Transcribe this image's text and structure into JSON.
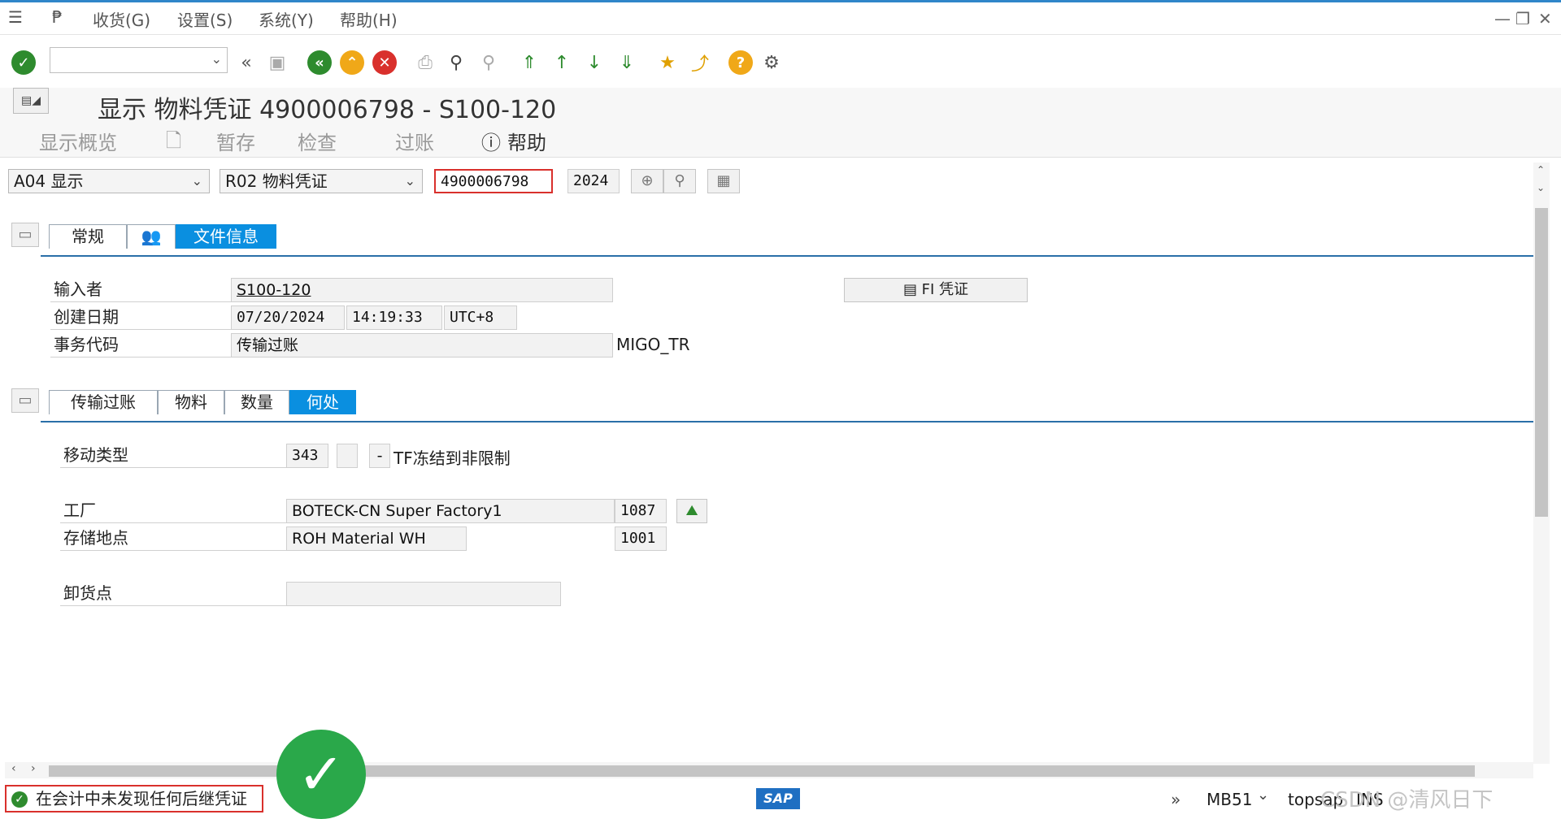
{
  "menubar": {
    "items": [
      "收货(G)",
      "设置(S)",
      "系统(Y)",
      "帮助(H)"
    ]
  },
  "title": "显示 物料凭证 4900006798 - S100-120",
  "app_toolbar": {
    "overview": "显示概览",
    "hold": "暂存",
    "check": "检查",
    "post": "过账",
    "help": "帮助"
  },
  "header_fields": {
    "action": "A04 显示",
    "reference": "R02 物料凭证",
    "doc_number": "4900006798",
    "year": "2024"
  },
  "header_tabs": {
    "general": "常规",
    "doc_info": "文件信息"
  },
  "doc_info": {
    "entered_by_label": "输入者",
    "entered_by": "S100-120",
    "created_label": "创建日期",
    "created_date": "07/20/2024",
    "created_time": "14:19:33",
    "created_tz": "UTC+8",
    "tcode_label": "事务代码",
    "tcode_text": "传输过账",
    "tcode": "MIGO_TR",
    "fi_button": "FI 凭证"
  },
  "item_tabs": {
    "transfer": "传输过账",
    "material": "物料",
    "quantity": "数量",
    "where": "何处"
  },
  "where": {
    "movement_label": "移动类型",
    "movement_type": "343",
    "movement_sign": "-",
    "movement_text": "TF冻结到非限制",
    "plant_label": "工厂",
    "plant_name": "BOTECK-CN Super Factory1",
    "plant_code": "1087",
    "sloc_label": "存储地点",
    "sloc_name": "ROH Material WH",
    "sloc_code": "1001",
    "unload_label": "卸货点",
    "unload_value": ""
  },
  "status": {
    "message": "在会计中未发现任何后继凭证",
    "tcode": "MB51",
    "server": "topsap",
    "mode": "INS",
    "watermark": "CSDN @清风日下"
  }
}
